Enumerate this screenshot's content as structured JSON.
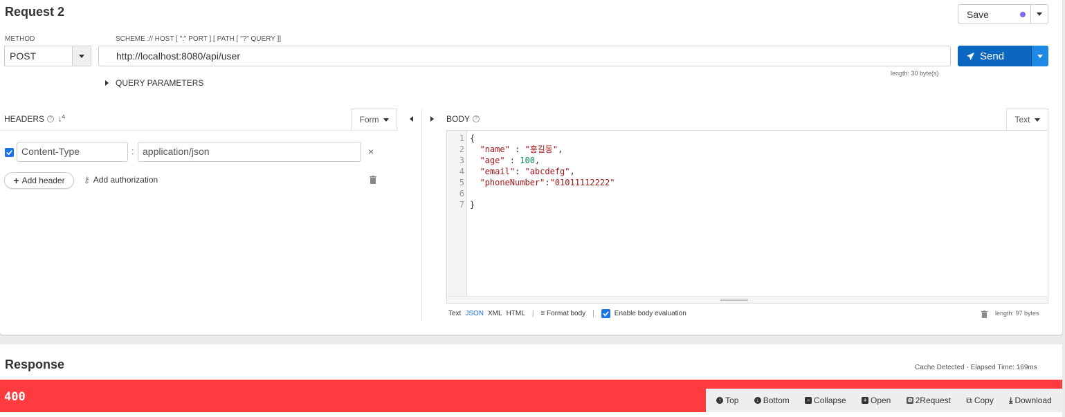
{
  "request": {
    "title": "Request 2",
    "save_label": "Save",
    "method_label": "METHOD",
    "method_value": "POST",
    "url_label": "SCHEME :// HOST [ \":\" PORT ] [ PATH [ \"?\" QUERY ]]",
    "url_value": "http://localhost:8080/api/user",
    "send_label": "Send",
    "url_length": "length: 30 byte(s)",
    "query_parameters": "QUERY PARAMETERS"
  },
  "headers": {
    "title": "HEADERS",
    "form_label": "Form",
    "items": [
      {
        "name": "Content-Type",
        "value": "application/json",
        "enabled": true
      }
    ],
    "colon": ":",
    "remove": "×",
    "add_header": "Add header",
    "add_authorization": "Add authorization"
  },
  "body": {
    "title": "BODY",
    "type_label": "Text",
    "line_numbers": [
      "1",
      "2",
      "3",
      "4",
      "5",
      "6",
      "7"
    ],
    "formats": [
      "Text",
      "JSON",
      "XML",
      "HTML"
    ],
    "active_format": "JSON",
    "format_body": "Format body",
    "enable_eval": "Enable body evaluation",
    "length": "length: 97 bytes"
  },
  "response": {
    "title": "Response",
    "cache_info": "Cache Detected - Elapsed Time: 169ms",
    "status_code": "400",
    "status_color": "#ff3b3f",
    "actions": [
      "Top",
      "Bottom",
      "Collapse",
      "Open",
      "2Request",
      "Copy",
      "Download"
    ]
  },
  "colors": {
    "send": "#0b67c2",
    "accent": "#1a73e8",
    "error": "#ff3b3f"
  }
}
